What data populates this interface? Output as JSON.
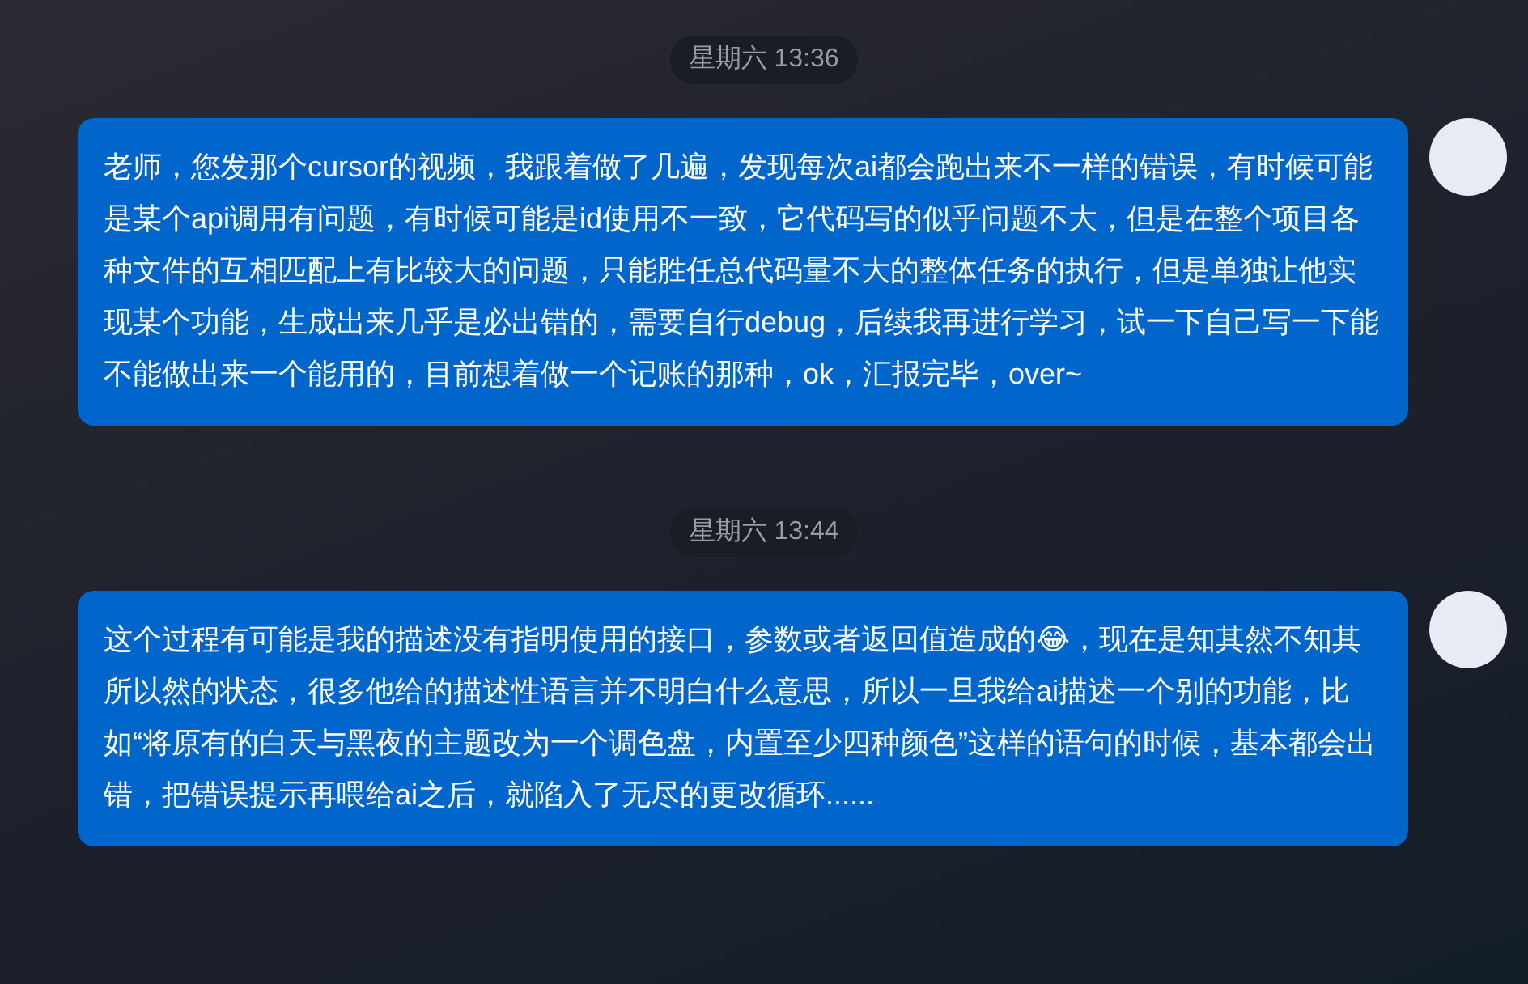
{
  "messages": [
    {
      "time": "星期六 13:36",
      "text": "老师，您发那个cursor的视频，我跟着做了几遍，发现每次ai都会跑出来不一样的错误，有时候可能是某个api调用有问题，有时候可能是id使用不一致，它代码写的似乎问题不大，但是在整个项目各种文件的互相匹配上有比较大的问题，只能胜任总代码量不大的整体任务的执行，但是单独让他实现某个功能，生成出来几乎是必出错的，需要自行debug，后续我再进行学习，试一下自己写一下能不能做出来一个能用的，目前想着做一个记账的那种，ok，汇报完毕，over~"
    },
    {
      "time": "星期六 13:44",
      "text": "这个过程有可能是我的描述没有指明使用的接口，参数或者返回值造成的😂，现在是知其然不知其所以然的状态，很多他给的描述性语言并不明白什么意思，所以一旦我给ai描述一个别的功能，比如“将原有的白天与黑夜的主题改为一个调色盘，内置至少四种颜色”这样的语句的时候，基本都会出错，把错误提示再喂给ai之后，就陷入了无尽的更改循环......"
    }
  ]
}
